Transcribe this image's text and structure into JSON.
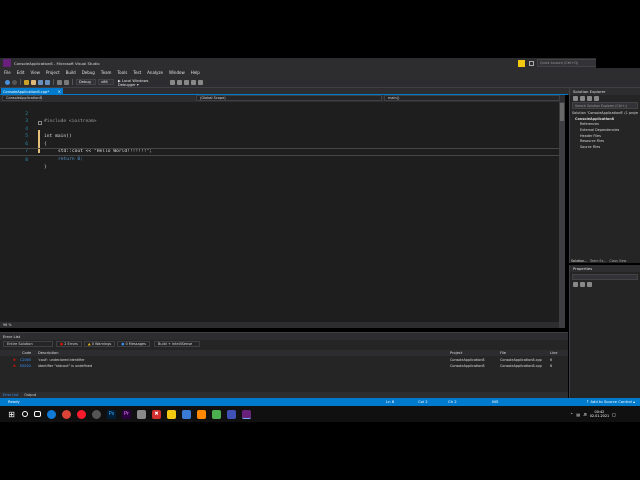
{
  "title_bar": {
    "title": "ConsoleApplication8 - Microsoft Visual Studio",
    "quick_launch_placeholder": "Quick Launch (Ctrl+Q)"
  },
  "menu": [
    "File",
    "Edit",
    "View",
    "Project",
    "Build",
    "Debug",
    "Team",
    "Tools",
    "Test",
    "Analyze",
    "Window",
    "Help"
  ],
  "toolbar": {
    "configuration": "Debug",
    "platform": "x86",
    "debugger": "▶ Local Windows Debugger ▾"
  },
  "document_tab": {
    "label": "ConsoleApplication8.cpp*",
    "close": "×"
  },
  "editor": {
    "project_combo": "ConsoleApplication8",
    "scope_combo": "(Global Scope)",
    "member_combo": "main()",
    "lines": [
      {
        "number": "2",
        "text": "#include <iostream>"
      },
      {
        "number": "3",
        "text": ""
      },
      {
        "number": "4",
        "text": "int main()"
      },
      {
        "number": "5",
        "text": "{"
      },
      {
        "number": "6",
        "text": "std::cout << \"Hello World!!!!!!!\";"
      },
      {
        "number": "7",
        "text": "return 0;"
      },
      {
        "number": "8",
        "text": "}"
      }
    ],
    "zoom": "96 %"
  },
  "solution_explorer": {
    "title": "Solution Explorer",
    "search_placeholder": "Search Solution Explorer (Ctrl+;)",
    "items": [
      "Solution 'ConsoleApplication8' (1 project)",
      "ConsoleApplication8",
      "References",
      "External Dependencies",
      "Header Files",
      "Resource Files",
      "Source Files"
    ],
    "tabs": [
      "Solution...",
      "Team Ex...",
      "Class View"
    ]
  },
  "properties": {
    "title": "Properties"
  },
  "error_list": {
    "title": "Error List",
    "scope": "Entire Solution",
    "errors_button": "2 Errors",
    "warnings_button": "0 Warnings",
    "messages_button": "0 Messages",
    "build_filter": "Build + IntelliSense",
    "columns": [
      "Code",
      "Description",
      "Project",
      "File",
      "Line"
    ],
    "rows": [
      {
        "code": "C2065",
        "description": "'cout': undeclared identifier",
        "project": "ConsoleApplication8",
        "file": "ConsoleApplication8.cpp",
        "line": "6"
      },
      {
        "code": "E0020",
        "description": "identifier \"stdcout\" is undefined",
        "project": "ConsoleApplication8",
        "file": "ConsoleApplication8.cpp",
        "line": "6"
      }
    ],
    "bottom_tabs": [
      "Error List",
      "Output"
    ]
  },
  "status_bar": {
    "state": "Ready",
    "ln": "Ln 8",
    "col": "Col 2",
    "ch": "Ch 2",
    "mode": "INS",
    "source_control": "↑ Add to Source Control ▴"
  },
  "taskbar": {
    "time": "00:42",
    "date": "02.01.2021"
  },
  "colors": {
    "accent": "#007acc",
    "editor_bg": "#1e1e1e",
    "chrome_bg": "#2d2d30",
    "vs_purple": "#68217a"
  }
}
